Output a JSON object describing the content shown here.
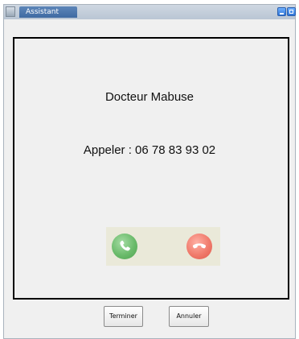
{
  "window": {
    "title": "Assistant",
    "controls": [
      "minimize-icon",
      "maximize-icon"
    ]
  },
  "call": {
    "contact_name": "Docteur Mabuse",
    "call_label": "Appeler : 06 78 83 93 02",
    "accept_icon": "phone-accept-icon",
    "decline_icon": "phone-decline-icon",
    "accept_color": "#6bbb6b",
    "decline_color": "#f07b6c"
  },
  "footer": {
    "end_label": "Terminer",
    "cancel_label": "Annuler"
  }
}
